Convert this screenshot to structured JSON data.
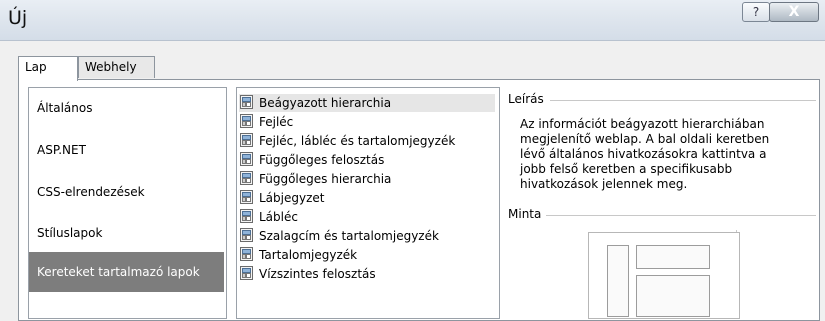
{
  "window": {
    "title": "Új",
    "help_label": "?",
    "close_label": "X"
  },
  "tabs": [
    {
      "label": "Lap",
      "active": true
    },
    {
      "label": "Webhely",
      "active": false
    }
  ],
  "categories": {
    "items": [
      {
        "label": "Általános"
      },
      {
        "label": "ASP.NET"
      },
      {
        "label": "CSS-elrendezések"
      },
      {
        "label": "Stíluslapok"
      },
      {
        "label": "Kereteket tartalmazó lapok",
        "selected": true
      }
    ]
  },
  "templates": {
    "icon": "framed-page-icon",
    "items": [
      {
        "label": "Beágyazott hierarchia",
        "selected": true
      },
      {
        "label": "Fejléc"
      },
      {
        "label": "Fejléc, lábléc és tartalomjegyzék"
      },
      {
        "label": "Függőleges felosztás"
      },
      {
        "label": "Függőleges hierarchia"
      },
      {
        "label": "Lábjegyzet"
      },
      {
        "label": "Lábléc"
      },
      {
        "label": "Szalagcím és tartalomjegyzék"
      },
      {
        "label": "Tartalomjegyzék"
      },
      {
        "label": "Vízszintes felosztás"
      }
    ]
  },
  "description": {
    "heading": "Leírás",
    "text": "Az információt beágyazott hierarchiában megjelenítő weblap. A bal oldali keretben lévő általános hivatkozásokra kattintva a jobb felső keretben a specifikusabb hivatkozások jelennek meg."
  },
  "sample": {
    "heading": "Minta"
  },
  "colors": {
    "selected_category_bg": "#7d7d7d",
    "selected_template_bg": "#e6e6e6"
  }
}
